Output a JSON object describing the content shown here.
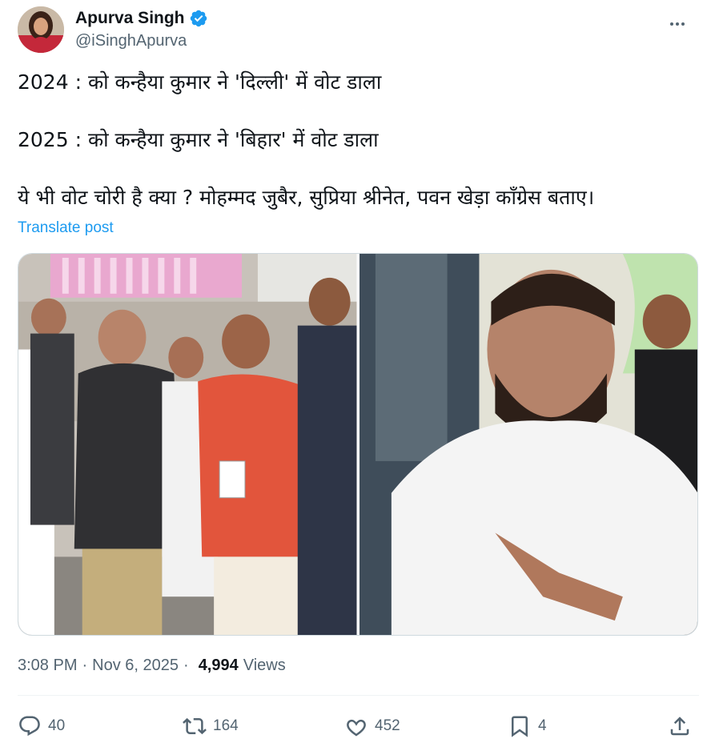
{
  "author": {
    "display_name": "Apurva Singh",
    "handle": "@iSinghApurva",
    "verified": true
  },
  "post": {
    "lines": [
      "2024 : को कन्हैया कुमार ने  'दिल्ली'  में वोट डाला",
      "2025 : को  कन्हैया कुमार ने  'बिहार'  में वोट डाला",
      "ये भी वोट चोरी है क्या ? मोहम्मद जुबैर,  सुप्रिया श्रीनेत, पवन खेड़ा कॉंग्रेस बताए।"
    ],
    "translate_label": "Translate post",
    "time": "3:08 PM",
    "date": "Nov 6, 2025",
    "views_count": "4,994",
    "views_label": "Views"
  },
  "actions": {
    "replies": "40",
    "reposts": "164",
    "likes": "452",
    "bookmarks": "4"
  },
  "icons": {
    "verified": "verified-badge-icon",
    "more": "more-options-icon",
    "reply": "reply-icon",
    "repost": "repost-icon",
    "like": "heart-icon",
    "bookmark": "bookmark-icon",
    "share": "share-icon"
  },
  "colors": {
    "accent": "#1d9bf0",
    "text": "#0f1419",
    "secondary": "#536471"
  }
}
